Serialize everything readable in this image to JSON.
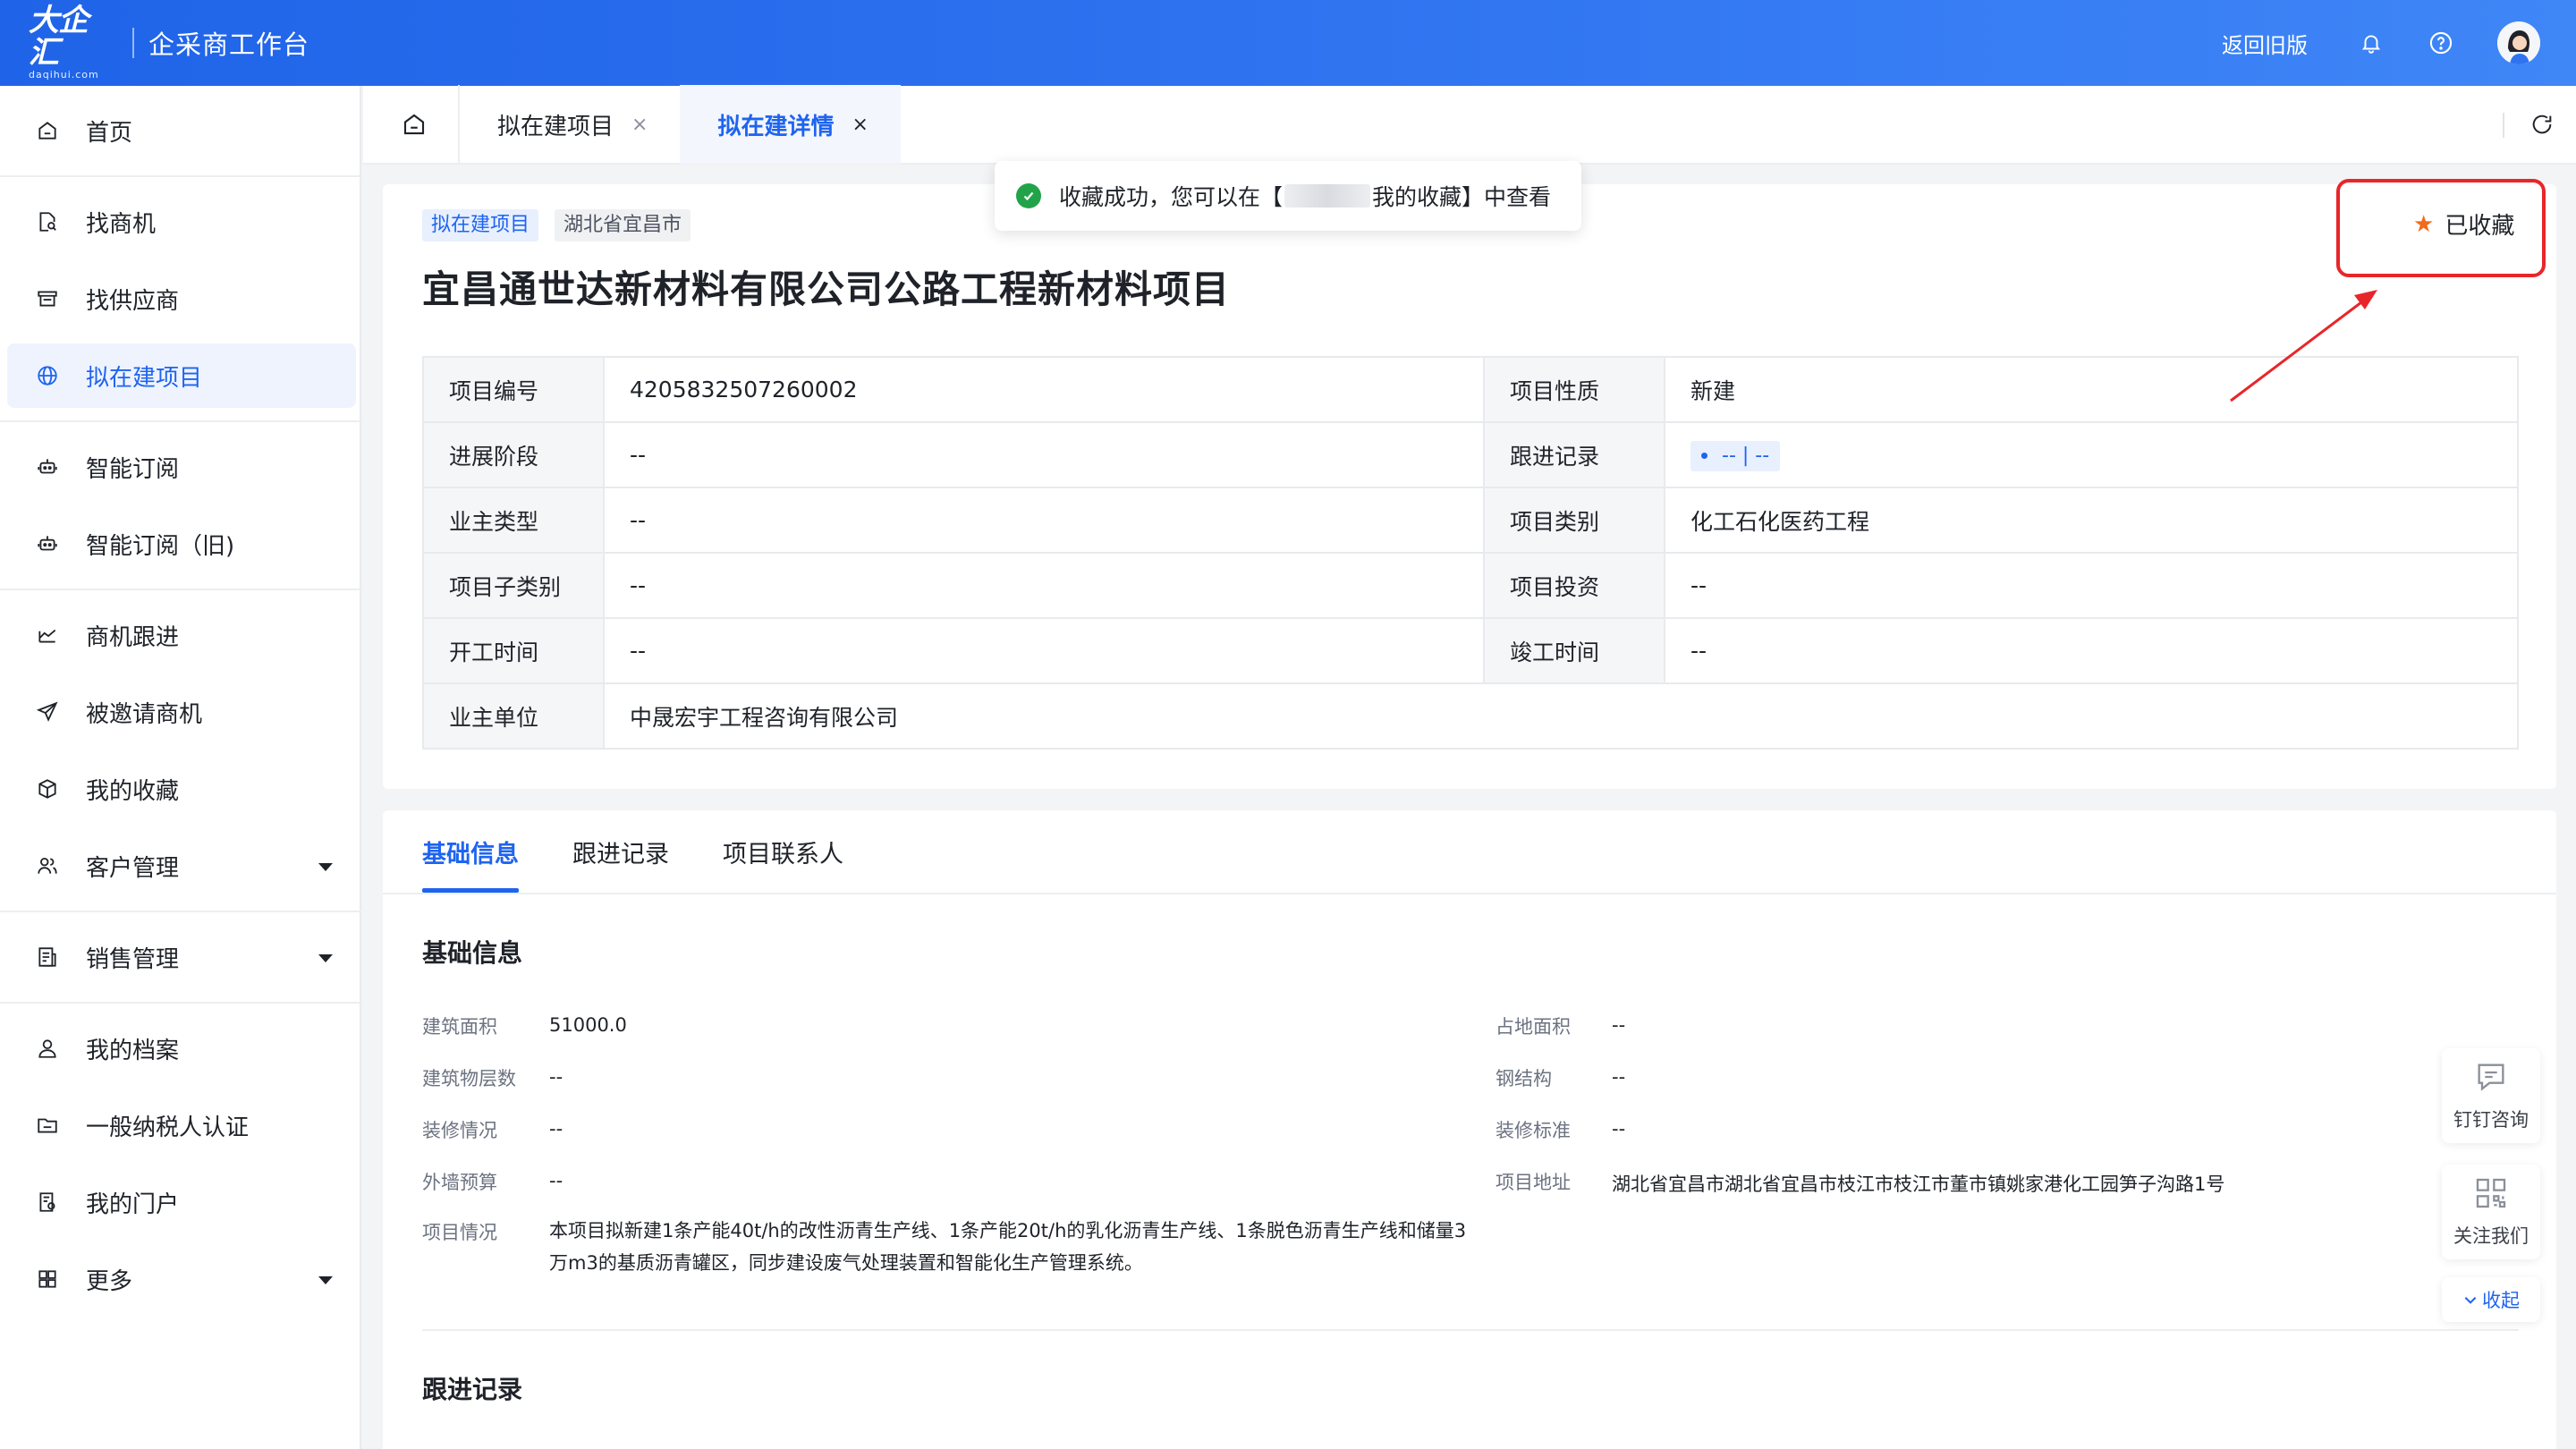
{
  "header": {
    "logo_main": "大企汇",
    "logo_sub": "daqihui.com",
    "app_title": "企采商工作台",
    "back_old": "返回旧版",
    "bell_icon": "bell-icon",
    "help_icon": "help-circle-icon"
  },
  "sidebar": {
    "items": [
      {
        "label": "首页",
        "icon": "home-icon"
      },
      {
        "label": "找商机",
        "icon": "doc-search-icon"
      },
      {
        "label": "找供应商",
        "icon": "store-icon"
      },
      {
        "label": "拟在建项目",
        "icon": "globe-icon"
      },
      {
        "label": "智能订阅",
        "icon": "robot-icon"
      },
      {
        "label": "智能订阅（旧)",
        "icon": "robot-icon"
      },
      {
        "label": "商机跟进",
        "icon": "chart-icon"
      },
      {
        "label": "被邀请商机",
        "icon": "send-icon"
      },
      {
        "label": "我的收藏",
        "icon": "box-icon"
      },
      {
        "label": "客户管理",
        "icon": "users-icon"
      },
      {
        "label": "销售管理",
        "icon": "report-icon"
      },
      {
        "label": "我的档案",
        "icon": "user-icon"
      },
      {
        "label": "一般纳税人认证",
        "icon": "folder-icon"
      },
      {
        "label": "我的门户",
        "icon": "portal-icon"
      },
      {
        "label": "更多",
        "icon": "grid-icon"
      }
    ]
  },
  "tabs": {
    "items": [
      {
        "label": "拟在建项目",
        "close": "×"
      },
      {
        "label": "拟在建详情",
        "close": "×"
      }
    ]
  },
  "toast": {
    "before": "收藏成功，您可以在【",
    "after": "我的收藏】中查看"
  },
  "project": {
    "tag_type": "拟在建项目",
    "tag_region": "湖北省宜昌市",
    "title": "宜昌通世达新材料有限公司公路工程新材料项目",
    "favorited_label": "已收藏",
    "table": {
      "r1": {
        "k1": "项目编号",
        "v1": "4205832507260002",
        "k2": "项目性质",
        "v2": "新建"
      },
      "r2": {
        "k1": "进展阶段",
        "v1": "--",
        "k2": "跟进记录",
        "v2": "-- | --"
      },
      "r3": {
        "k1": "业主类型",
        "v1": "--",
        "k2": "项目类别",
        "v2": "化工石化医药工程"
      },
      "r4": {
        "k1": "项目子类别",
        "v1": "--",
        "k2": "项目投资",
        "v2": "--"
      },
      "r5": {
        "k1": "开工时间",
        "v1": "--",
        "k2": "竣工时间",
        "v2": "--"
      },
      "r6": {
        "k1": "业主单位",
        "v1": "中晟宏宇工程咨询有限公司"
      }
    }
  },
  "detail": {
    "tabs": [
      "基础信息",
      "跟进记录",
      "项目联系人"
    ],
    "section_basic": "基础信息",
    "section_track": "跟进记录",
    "fields": {
      "build_area": {
        "k": "建筑面积",
        "v": "51000.0"
      },
      "land_area": {
        "k": "占地面积",
        "v": "--"
      },
      "floors": {
        "k": "建筑物层数",
        "v": "--"
      },
      "steel": {
        "k": "钢结构",
        "v": "--"
      },
      "decoration": {
        "k": "装修情况",
        "v": "--"
      },
      "decoration_std": {
        "k": "装修标准",
        "v": "--"
      },
      "wall_budget": {
        "k": "外墙预算",
        "v": "--"
      },
      "address": {
        "k": "项目地址",
        "v": "湖北省宜昌市湖北省宜昌市枝江市枝江市董市镇姚家港化工园笋子沟路1号"
      },
      "situation": {
        "k": "项目情况",
        "v": "本项目拟新建1条产能40t/h的改性沥青生产线、1条产能20t/h的乳化沥青生产线、1条脱色沥青生产线和储量3万m3的基质沥青罐区，同步建设废气处理装置和智能化生产管理系统。"
      }
    }
  },
  "floating": {
    "dingtalk": "钉钉咨询",
    "follow": "关注我们",
    "collapse": "收起"
  },
  "colors": {
    "brand_blue": "#1e64f0",
    "annotation_red": "#e8262a",
    "star_orange": "#f26a1b",
    "success_green": "#22a34a"
  }
}
